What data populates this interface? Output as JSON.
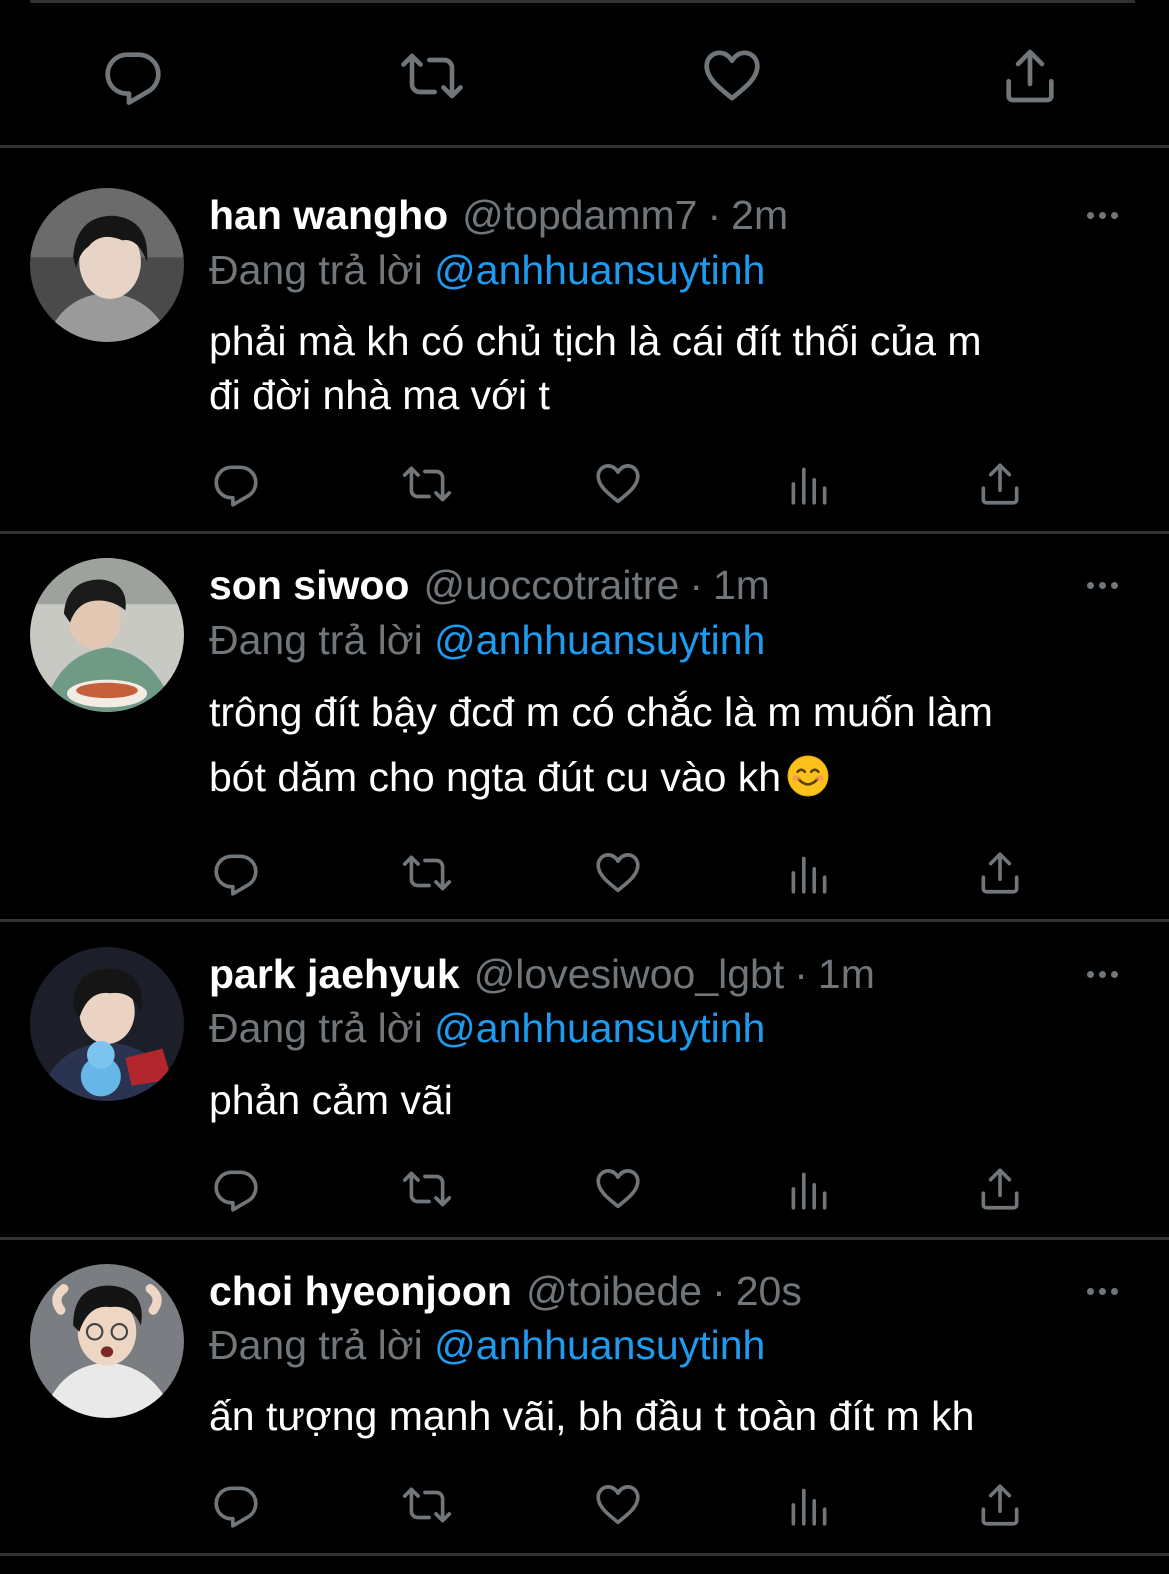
{
  "reply_label": "Đang trả lời",
  "tweets": [
    {
      "display_name": "han wangho",
      "handle": "@topdamm7",
      "separator": "·",
      "time": "2m",
      "reply_to": "@anhhuansuytinh",
      "text_lines": [
        "phải mà kh có chủ tịch là cái đít thối của m",
        "đi đời nhà ma với t"
      ]
    },
    {
      "display_name": "son siwoo",
      "handle": "@uoccotraitre",
      "separator": "·",
      "time": "1m",
      "reply_to": "@anhhuansuytinh",
      "text_lines": [
        "trông đít bậy đcđ m có chắc là m muốn làm",
        "bót dăm cho ngta đút cu vào kh"
      ],
      "emoji": "smiling-face-icon"
    },
    {
      "display_name": "park jaehyuk",
      "handle": "@lovesiwoo_lgbt",
      "separator": "·",
      "time": "1m",
      "reply_to": "@anhhuansuytinh",
      "text_lines": [
        "phản cảm vãi"
      ]
    },
    {
      "display_name": "choi hyeonjoon",
      "handle": "@toibede",
      "separator": "·",
      "time": "20s",
      "reply_to": "@anhhuansuytinh",
      "text_lines": [
        "ấn tượng mạnh vãi, bh đầu t toàn đít m kh"
      ]
    }
  ],
  "colors": {
    "background": "#000000",
    "text": "#ffffff",
    "muted": "#71767b",
    "link": "#1d9bf0",
    "divider": "#2f3336"
  },
  "icons": {
    "top_actions": [
      "reply-icon",
      "retweet-icon",
      "like-icon",
      "share-icon"
    ],
    "tweet_actions": [
      "reply-icon",
      "retweet-icon",
      "like-icon",
      "views-icon",
      "share-icon"
    ],
    "more": "more-options-icon"
  }
}
